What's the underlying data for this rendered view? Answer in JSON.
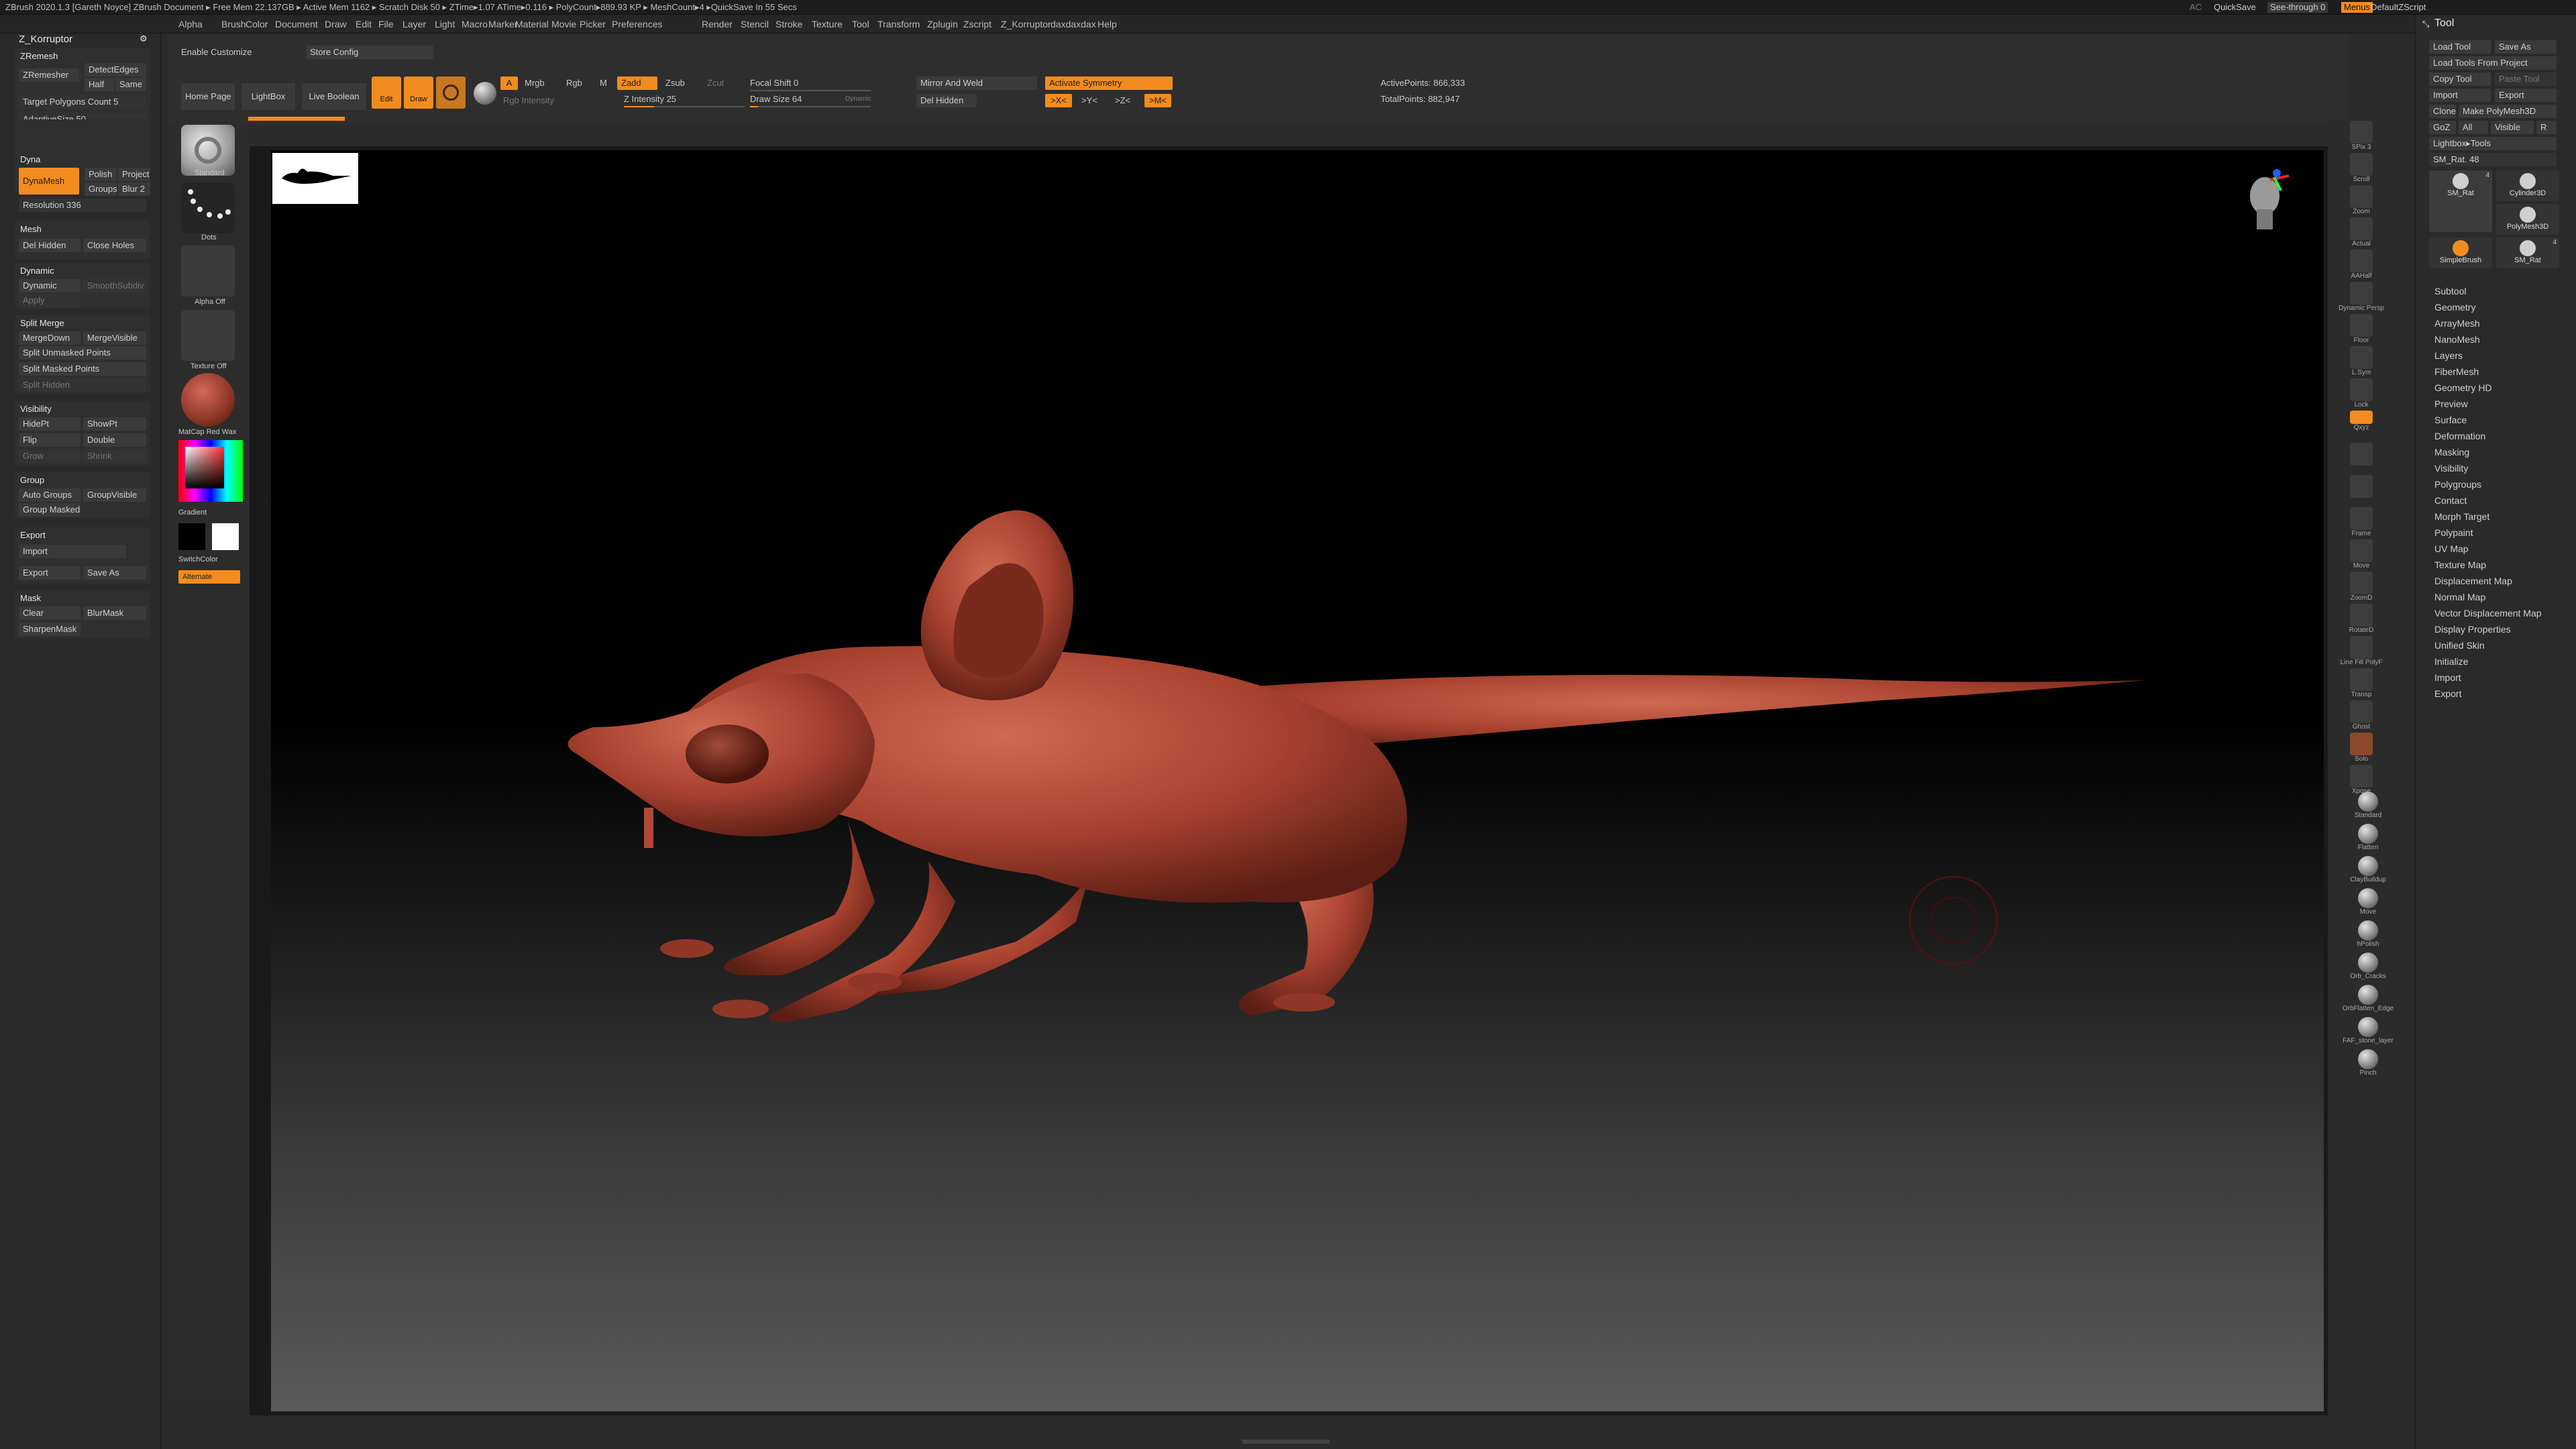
{
  "titlebar": {
    "text": "ZBrush 2020.1.3 [Gareth Noyce]   ZBrush Document   ▸ Free Mem 22.137GB ▸ Active Mem 1162 ▸ Scratch Disk 50 ▸ ZTime▸1.07 ATime▸0.116 ▸ PolyCount▸889.93 KP ▸ MeshCount▸4 ▸QuickSave In 55 Secs",
    "right": {
      "ac": "AC",
      "quicksave": "QuickSave",
      "see_through": "See-through  0",
      "menus": "Menus",
      "default_zscript": "DefaultZScript"
    }
  },
  "menubar": {
    "items": [
      "Alpha",
      "Brush",
      "Color",
      "Document",
      "Draw",
      "Edit",
      "File",
      "Layer",
      "Light",
      "Macro",
      "Marker",
      "Material",
      "Movie",
      "Picker",
      "Preferences",
      "Render",
      "Stencil",
      "Stroke",
      "Texture",
      "Tool",
      "Transform",
      "Zplugin",
      "Zscript",
      "Z_Korruptor",
      "daxdaxdax",
      "Help"
    ]
  },
  "left_tray": {
    "title": "Z_Korruptor",
    "zremesh": {
      "header": "ZRemesh",
      "zremesher": "ZRemesher",
      "detect_edges": "DetectEdges",
      "half": "Half",
      "same": "Same",
      "target": "Target Polygons Count 5",
      "adaptive": "AdaptiveSize 50"
    },
    "dyna": {
      "header": "Dyna",
      "dynamesh": "DynaMesh",
      "polish": "Polish",
      "project": "Project",
      "groups": "Groups",
      "blur": "Blur 2",
      "resolution": "Resolution 336"
    },
    "mesh": {
      "header": "Mesh",
      "del_hidden": "Del Hidden",
      "close_holes": "Close Holes"
    },
    "dynamic": {
      "header": "Dynamic",
      "dynamic": "Dynamic",
      "smooth_subdiv": "SmoothSubdiv",
      "apply": "Apply"
    },
    "split_merge": {
      "header": "Split Merge",
      "merge_down": "MergeDown",
      "merge_visible": "MergeVisible",
      "split_unmasked": "Split Unmasked Points",
      "split_masked": "Split Masked Points",
      "split_hidden": "Split Hidden"
    },
    "visibility": {
      "header": "Visibility",
      "hide_pt": "HidePt",
      "show_pt": "ShowPt",
      "flip": "Flip",
      "double": "Double",
      "grow": "Grow",
      "shrink": "Shrink"
    },
    "group": {
      "header": "Group",
      "auto_groups": "Auto Groups",
      "group_visible": "GroupVisible",
      "group_masked": "Group Masked"
    },
    "export": {
      "header": "Export",
      "import": "Import",
      "export": "Export",
      "save_as": "Save As"
    },
    "mask": {
      "header": "Mask",
      "clear": "Clear",
      "blur_mask": "BlurMask",
      "sharpen_mask": "SharpenMask"
    }
  },
  "top_shelf": {
    "enable_customize": "Enable Customize",
    "store_config": "Store Config",
    "home_page": "Home Page",
    "lightbox": "LightBox",
    "live_boolean": "Live Boolean",
    "edit": "Edit",
    "draw": "Draw",
    "a": "A",
    "mrgb": "Mrgb",
    "rgb": "Rgb",
    "m": "M",
    "zadd": "Zadd",
    "zsub": "Zsub",
    "zcut": "Zcut",
    "rgb_intensity": "Rgb Intensity",
    "z_intensity": "Z Intensity 25",
    "z_intensity_value": 25,
    "focal_shift": "Focal Shift 0",
    "draw_size": "Draw Size 64",
    "draw_size_value": 64,
    "dynamic": "Dynamic",
    "mirror_weld": "Mirror And Weld",
    "activate_symmetry": "Activate Symmetry",
    "del_hidden": "Del Hidden",
    "x": ">X<",
    "y": ">Y<",
    "z": ">Z<",
    "m_sym": ">M<",
    "active_points": "ActivePoints: 866,333",
    "total_points": "TotalPoints: 882,947"
  },
  "left_shelf": {
    "brush": "Standard",
    "stroke": "Dots",
    "alpha": "Alpha Off",
    "texture": "Texture Off",
    "material": "MatCap Red Wax",
    "gradient": "Gradient",
    "switch_color": "SwitchColor",
    "alternate": "Alternate"
  },
  "right_shelf": {
    "items": [
      "SPix 3",
      "Scroll",
      "Zoom",
      "Actual",
      "AAHalf",
      "Dynamic Persp",
      "Floor",
      "L.Sym",
      "Lock",
      "Qxyz",
      "",
      "",
      "Frame",
      "Move",
      "ZoomD",
      "RotateD",
      "Line Fill PolyF",
      "Transp",
      "Ghost",
      "Solo",
      "Xpose"
    ],
    "brushes": [
      "Standard",
      "Flatten",
      "ClayBuildup",
      "Move",
      "hPolish",
      "Orb_Cracks",
      "OrbFlatten_Edge",
      "FAF_stone_layer",
      "Pinch"
    ]
  },
  "right_tray": {
    "title": "Tool",
    "load_tool": "Load Tool",
    "save_as": "Save As",
    "load_from_project": "Load Tools From Project",
    "copy_tool": "Copy Tool",
    "paste_tool": "Paste Tool",
    "import": "Import",
    "export": "Export",
    "clone": "Clone",
    "make_polymesh": "Make PolyMesh3D",
    "goz": "GoZ",
    "all": "All",
    "visible": "Visible",
    "r": "R",
    "lightbox_tools": "Lightbox▸Tools",
    "sm_rat": "SM_Rat. 48",
    "thumbs": [
      "SM_Rat",
      "Cylinder3D",
      "PolyMesh3D",
      "SimpleBrush",
      "SM_Rat"
    ],
    "thumb_counts": [
      "4",
      "",
      "",
      "",
      "4"
    ],
    "list": [
      "Subtool",
      "Geometry",
      "ArrayMesh",
      "NanoMesh",
      "Layers",
      "FiberMesh",
      "Geometry HD",
      "Preview",
      "Surface",
      "Deformation",
      "Masking",
      "Visibility",
      "Polygroups",
      "Contact",
      "Morph Target",
      "Polypaint",
      "UV Map",
      "Texture Map",
      "Displacement Map",
      "Normal Map",
      "Vector Displacement Map",
      "Display Properties",
      "Unified Skin",
      "Initialize",
      "Import",
      "Export"
    ]
  },
  "colors": {
    "accent": "#f28c1e",
    "rat": "#b24a38",
    "background": "#2b2b2b"
  }
}
